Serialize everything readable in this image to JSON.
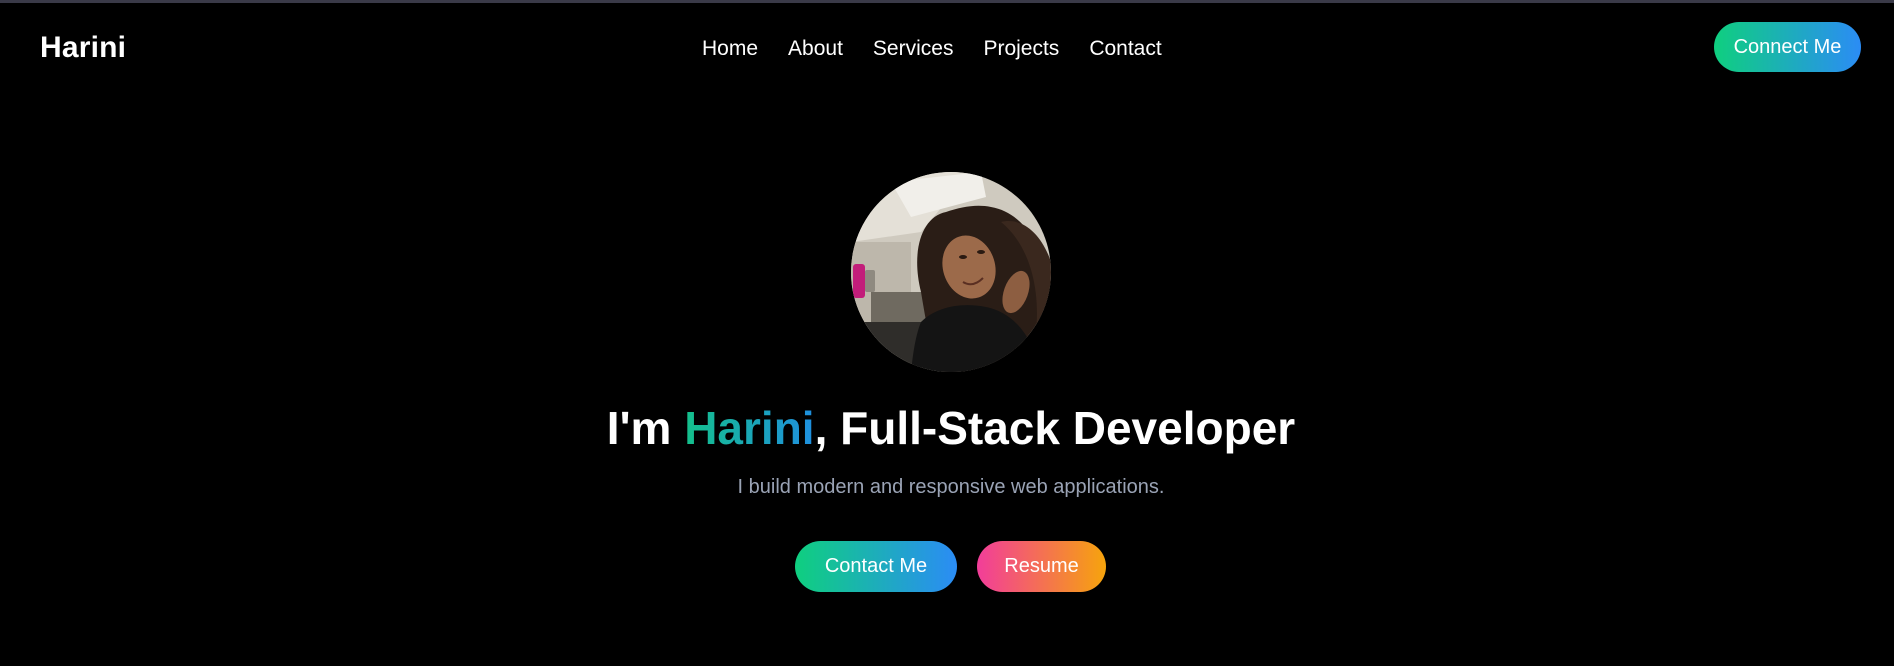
{
  "brand": {
    "name": "Harini"
  },
  "nav": {
    "items": [
      {
        "label": "Home"
      },
      {
        "label": "About"
      },
      {
        "label": "Services"
      },
      {
        "label": "Projects"
      },
      {
        "label": "Contact"
      }
    ],
    "connect_label": "Connect Me"
  },
  "hero": {
    "headline_prefix": "I'm ",
    "headline_name": "Harini",
    "headline_suffix": ", Full-Stack Developer",
    "subtitle": "I build modern and responsive web applications.",
    "contact_label": "Contact Me",
    "resume_label": "Resume"
  },
  "colors": {
    "background": "#000000",
    "green_gradient_start": "#0fcf7f",
    "blue_gradient_end": "#2b8cf5",
    "pink_gradient_start": "#f23d9a",
    "orange_gradient_end": "#f6a40c",
    "subtitle_gray": "#9aa3b5"
  }
}
